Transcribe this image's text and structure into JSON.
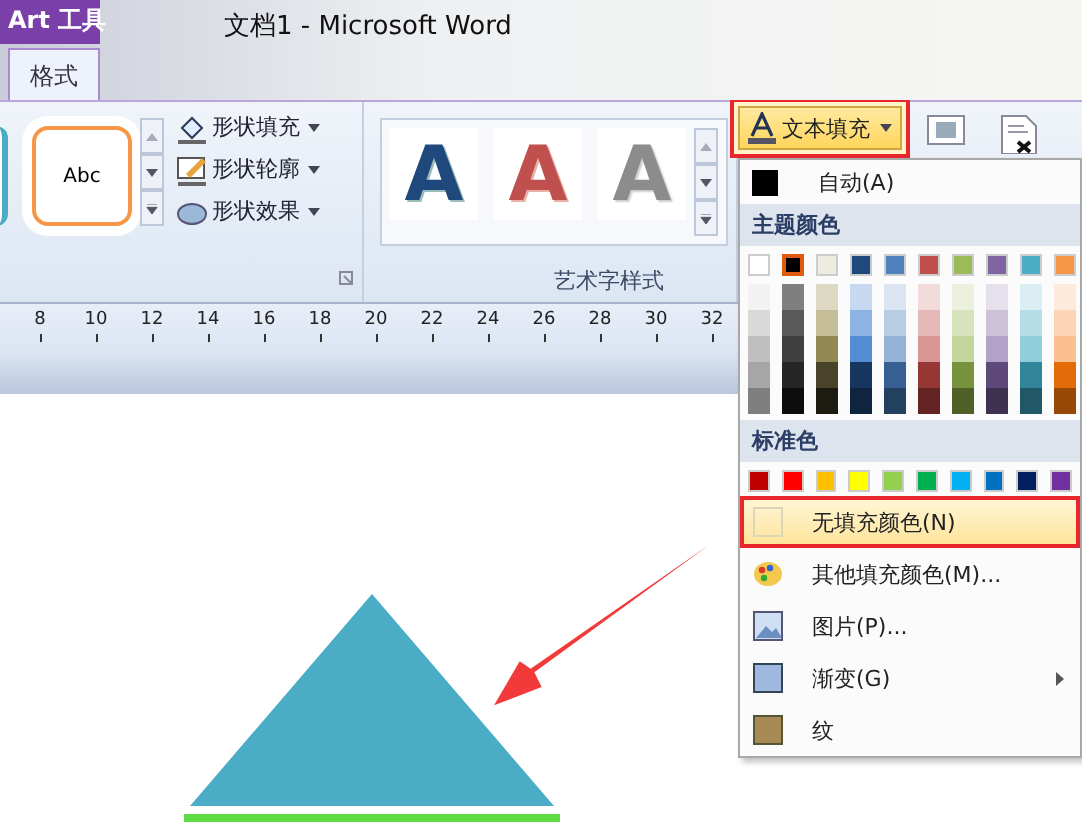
{
  "window": {
    "title": "文档1  -  Microsoft Word"
  },
  "contextual_tab": {
    "label": "Art 工具"
  },
  "tabs": [
    {
      "label": "格式",
      "selected": true
    }
  ],
  "shape_styles": [
    {
      "text": "Abc",
      "color": "#f79646"
    }
  ],
  "shape_commands": [
    {
      "kind": "fill",
      "label": "形状填充"
    },
    {
      "kind": "outline",
      "label": "形状轮廓"
    },
    {
      "kind": "effects",
      "label": "形状效果"
    }
  ],
  "wordart_styles": [
    {
      "text": "A",
      "kind": "blue"
    },
    {
      "text": "A",
      "kind": "red"
    },
    {
      "text": "A",
      "kind": "grey"
    }
  ],
  "group_label": "艺术字样式",
  "text_fill_button": {
    "label": "文本填充",
    "highlighted": true
  },
  "ruler": {
    "ticks": [
      "8",
      "10",
      "12",
      "14",
      "16",
      "18",
      "20",
      "22",
      "24",
      "26",
      "28",
      "30",
      "32"
    ]
  },
  "menu": {
    "auto": {
      "label": "自动(A)",
      "color": "#000000"
    },
    "theme_header": "主题颜色",
    "theme_colors": [
      {
        "color": "#ffffff",
        "selected": false,
        "shades": [
          {
            "color": "#f2f2f2"
          },
          {
            "color": "#d9d9d9"
          },
          {
            "color": "#bfbfbf"
          },
          {
            "color": "#a6a6a6"
          },
          {
            "color": "#7f7f7f"
          }
        ]
      },
      {
        "color": "#000000",
        "selected": true,
        "shades": [
          {
            "color": "#7f7f7f"
          },
          {
            "color": "#595959"
          },
          {
            "color": "#3f3f3f"
          },
          {
            "color": "#262626"
          },
          {
            "color": "#0d0d0d"
          }
        ]
      },
      {
        "color": "#eeece1",
        "selected": false,
        "shades": [
          {
            "color": "#ddd9c3"
          },
          {
            "color": "#c4bd97"
          },
          {
            "color": "#938953"
          },
          {
            "color": "#494429"
          },
          {
            "color": "#1d1b10"
          }
        ]
      },
      {
        "color": "#1f497d",
        "selected": false,
        "shades": [
          {
            "color": "#c6d9f0"
          },
          {
            "color": "#8db3e2"
          },
          {
            "color": "#548dd4"
          },
          {
            "color": "#17365d"
          },
          {
            "color": "#0f243e"
          }
        ]
      },
      {
        "color": "#4f81bd",
        "selected": false,
        "shades": [
          {
            "color": "#dbe5f1"
          },
          {
            "color": "#b8cce4"
          },
          {
            "color": "#95b3d7"
          },
          {
            "color": "#366092"
          },
          {
            "color": "#244061"
          }
        ]
      },
      {
        "color": "#c0504d",
        "selected": false,
        "shades": [
          {
            "color": "#f2dcdb"
          },
          {
            "color": "#e5b9b7"
          },
          {
            "color": "#d99694"
          },
          {
            "color": "#953734"
          },
          {
            "color": "#632423"
          }
        ]
      },
      {
        "color": "#9bbb59",
        "selected": false,
        "shades": [
          {
            "color": "#ebf1dd"
          },
          {
            "color": "#d7e3bc"
          },
          {
            "color": "#c3d69b"
          },
          {
            "color": "#76923c"
          },
          {
            "color": "#4f6128"
          }
        ]
      },
      {
        "color": "#8064a2",
        "selected": false,
        "shades": [
          {
            "color": "#e5e0ec"
          },
          {
            "color": "#ccc1d9"
          },
          {
            "color": "#b2a2c7"
          },
          {
            "color": "#5f497a"
          },
          {
            "color": "#3f3151"
          }
        ]
      },
      {
        "color": "#4bacc6",
        "selected": false,
        "shades": [
          {
            "color": "#dbeef3"
          },
          {
            "color": "#b7dde8"
          },
          {
            "color": "#92cddc"
          },
          {
            "color": "#31859b"
          },
          {
            "color": "#205867"
          }
        ]
      },
      {
        "color": "#f79646",
        "selected": false,
        "shades": [
          {
            "color": "#fdeada"
          },
          {
            "color": "#fbd5b5"
          },
          {
            "color": "#fac08f"
          },
          {
            "color": "#e36c09"
          },
          {
            "color": "#974806"
          }
        ]
      }
    ],
    "standard_header": "标准色",
    "standard_colors": [
      {
        "color": "#c00000"
      },
      {
        "color": "#ff0000"
      },
      {
        "color": "#ffc000"
      },
      {
        "color": "#ffff00"
      },
      {
        "color": "#92d050"
      },
      {
        "color": "#00b050"
      },
      {
        "color": "#00b0f0"
      },
      {
        "color": "#0070c0"
      },
      {
        "color": "#002060"
      },
      {
        "color": "#7030a0"
      }
    ],
    "items": [
      {
        "kind": "no-fill",
        "label": "无填充颜色(N)",
        "selected": true,
        "has_submenu": false
      },
      {
        "kind": "more-colors",
        "label": "其他填充颜色(M)...",
        "selected": false,
        "has_submenu": false
      },
      {
        "kind": "picture",
        "label": "图片(P)...",
        "selected": false,
        "has_submenu": false
      },
      {
        "kind": "gradient",
        "label": "渐变(G)",
        "selected": false,
        "has_submenu": true
      },
      {
        "kind": "texture",
        "label": "纹",
        "selected": false,
        "has_submenu": false
      }
    ]
  }
}
